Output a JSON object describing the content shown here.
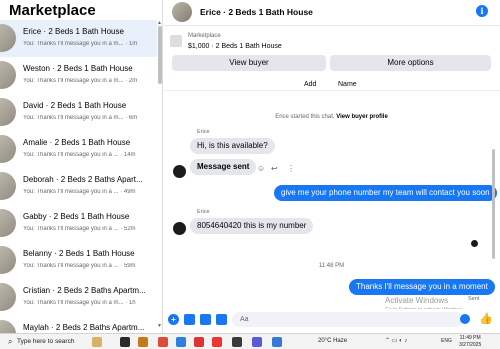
{
  "sidebar": {
    "title": "Marketplace",
    "conversations": [
      {
        "name": "Erice · 2 Beds 1 Bath House",
        "snippet": "You: Thanks I'll message you in a m... · 1m"
      },
      {
        "name": "Weston · 2 Beds 1 Bath House",
        "snippet": "You: Thanks I'll message you in a m... · 2m"
      },
      {
        "name": "David · 2 Beds 1 Bath House",
        "snippet": "You: Thanks I'll message you in a m... · 6m"
      },
      {
        "name": "Amalie · 2 Beds 1 Bath House",
        "snippet": "You: Thanks I'll message you in a ... · 14m"
      },
      {
        "name": "Deborah · 2 Beds 2 Baths Apart...",
        "snippet": "You: Thanks I'll message you in a ... · 49m"
      },
      {
        "name": "Gabby · 2 Beds 1 Bath House",
        "snippet": "You: Thanks I'll message you in a ... · 52m"
      },
      {
        "name": "Belanny · 2 Beds 1 Bath House",
        "snippet": "You: Thanks I'll message you in a ... · 59m"
      },
      {
        "name": "Cristian · 2 Beds 2 Baths Apartm...",
        "snippet": "You: Thanks I'll message you in a m... · 1h"
      },
      {
        "name": "Maylah · 2 Beds 2 Baths Apartm...",
        "snippet": ""
      }
    ]
  },
  "chat": {
    "header_name": "Erice · 2 Beds 1 Bath House",
    "listing_label": "Marketplace",
    "listing_price": "$1,000 · 2 Beds 1 Bath House",
    "view_buyer": "View buyer",
    "more_options": "More options",
    "add_label": "Add",
    "name_label": "Name",
    "system_prefix": "Erice started this chat.",
    "system_link": "View buyer profile",
    "sender_1": "Erice",
    "msg_1": "Hi, is this available?",
    "msg_2": "Message sent",
    "msg_3": "give me your phone number my team will contact you soon",
    "sender_2": "Erice",
    "msg_4": "8054640420 this is my number",
    "timestamp": "11:48 PM",
    "msg_5": "Thanks I'll message you in a moment",
    "sent_label": "Sent",
    "activate_title": "Activate Windows",
    "activate_sub": "Go to Settings to activate Windows.",
    "composer_placeholder": "Aa"
  },
  "taskbar": {
    "search_placeholder": "Type here to search",
    "weather": "20°C  Haze",
    "language": "ENG",
    "time": "11:49 PM",
    "date": "3/27/2025"
  },
  "colors": {
    "accent": "#1877f2",
    "bubble_in": "#e4e6eb"
  }
}
